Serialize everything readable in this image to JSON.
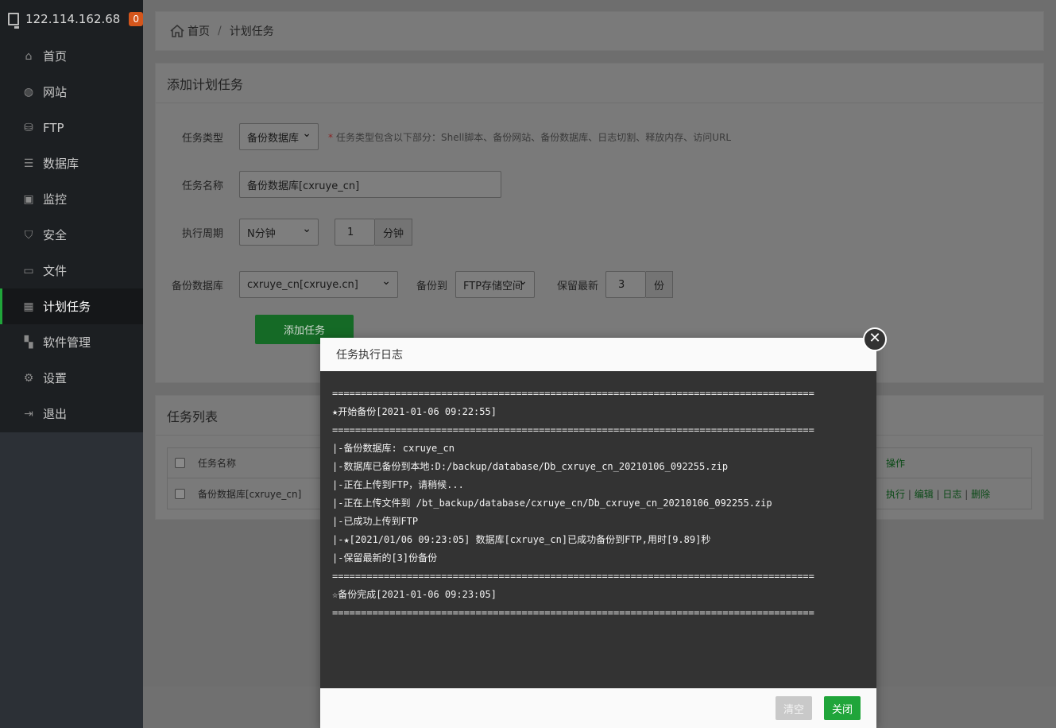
{
  "sidebar": {
    "ip": "122.114.162.68",
    "badge": "0",
    "items": [
      {
        "label": "首页",
        "icon": "home-icon"
      },
      {
        "label": "网站",
        "icon": "globe-icon"
      },
      {
        "label": "FTP",
        "icon": "ftp-icon"
      },
      {
        "label": "数据库",
        "icon": "database-icon"
      },
      {
        "label": "监控",
        "icon": "monitor-chart-icon"
      },
      {
        "label": "安全",
        "icon": "shield-icon"
      },
      {
        "label": "文件",
        "icon": "folder-icon"
      },
      {
        "label": "计划任务",
        "icon": "calendar-icon"
      },
      {
        "label": "软件管理",
        "icon": "grid-icon"
      },
      {
        "label": "设置",
        "icon": "gear-icon"
      },
      {
        "label": "退出",
        "icon": "logout-icon"
      }
    ]
  },
  "breadcrumb": {
    "home": "首页",
    "current": "计划任务"
  },
  "add_task": {
    "title": "添加计划任务",
    "type_label": "任务类型",
    "type_value": "备份数据库",
    "type_hint_star": "*",
    "type_hint": "任务类型包含以下部分：Shell脚本、备份网站、备份数据库、日志切割、释放内存、访问URL",
    "name_label": "任务名称",
    "name_value": "备份数据库[cxruye_cn]",
    "period_label": "执行周期",
    "period_value": "N分钟",
    "period_num": "1",
    "period_unit": "分钟",
    "db_label": "备份数据库",
    "db_value": "cxruye_cn[cxruye.cn]",
    "backup_to_label": "备份到",
    "backup_to_value": "FTP存储空间",
    "keep_label": "保留最新",
    "keep_value": "3",
    "keep_unit": "份",
    "add_button": "添加任务"
  },
  "task_list": {
    "title": "任务列表",
    "col_name": "任务名称",
    "col_ops": "操作",
    "rows": [
      {
        "name": "备份数据库[cxruye_cn]",
        "ops": [
          "执行",
          "编辑",
          "日志",
          "删除"
        ]
      }
    ]
  },
  "dialog": {
    "title": "任务执行日志",
    "lines": [
      "====================================================================================",
      "★开始备份[2021-01-06 09:22:55]",
      "====================================================================================",
      "|-备份数据库: cxruye_cn",
      "|-数据库已备份到本地:D:/backup/database/Db_cxruye_cn_20210106_092255.zip",
      "|-正在上传到FTP，请稍候...",
      "|-正在上传文件到 /bt_backup/database/cxruye_cn/Db_cxruye_cn_20210106_092255.zip",
      "|-已成功上传到FTP",
      "|-★[2021/01/06 09:23:05] 数据库[cxruye_cn]已成功备份到FTP,用时[9.89]秒",
      "|-保留最新的[3]份备份",
      "====================================================================================",
      "☆备份完成[2021-01-06 09:23:05]",
      "===================================================================================="
    ],
    "clear_button": "清空",
    "close_button": "关闭"
  }
}
